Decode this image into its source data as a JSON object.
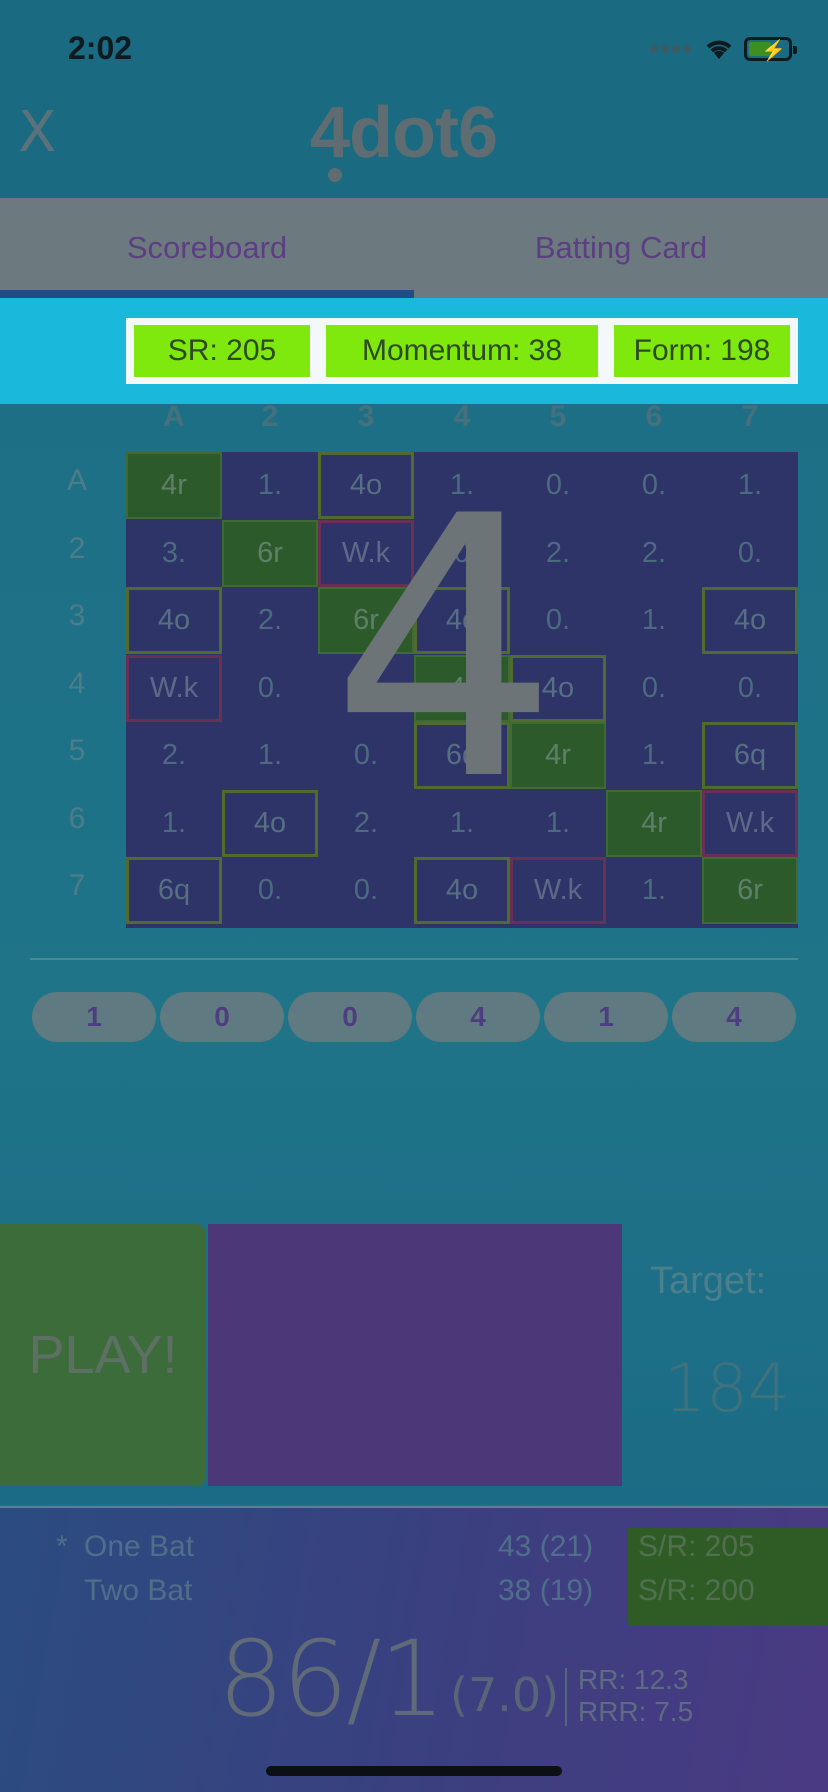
{
  "status_bar": {
    "time": "2:02"
  },
  "header": {
    "close_label": "X",
    "logo": "4dot6"
  },
  "tabs": [
    {
      "label": "Scoreboard",
      "active": true
    },
    {
      "label": "Batting Card",
      "active": false
    }
  ],
  "stats": {
    "sr": "SR: 205",
    "momentum": "Momentum: 38",
    "form": "Form: 198"
  },
  "grid": {
    "columns": [
      "A",
      "2",
      "3",
      "4",
      "5",
      "6",
      "7"
    ],
    "rows": [
      "A",
      "2",
      "3",
      "4",
      "5",
      "6",
      "7"
    ],
    "cells": [
      [
        "4r",
        "1.",
        "4o",
        "1.",
        "0.",
        "0.",
        "1."
      ],
      [
        "3.",
        "6r",
        "W.k",
        "0",
        "2.",
        "2.",
        "0."
      ],
      [
        "4o",
        "2.",
        "6r",
        "4o",
        "0.",
        "1.",
        "4o"
      ],
      [
        "W.k",
        "0.",
        "1",
        "4r",
        "4o",
        "0.",
        "0."
      ],
      [
        "2.",
        "1.",
        "0.",
        "6q",
        "4r",
        "1.",
        "6q"
      ],
      [
        "1.",
        "4o",
        "2.",
        "1.",
        "1.",
        "4r",
        "W.k"
      ],
      [
        "6q",
        "0.",
        "0.",
        "4o",
        "W.k",
        "1.",
        "6r"
      ]
    ],
    "overlay_value": "4"
  },
  "recent_balls": [
    "1",
    "0",
    "0",
    "4",
    "1",
    "4"
  ],
  "play": {
    "button_label": "PLAY!",
    "target_label": "Target:",
    "target_value": "184"
  },
  "batters": [
    {
      "marker": "*",
      "name": "One Bat",
      "score": "43 (21)",
      "strike_rate": "S/R: 205"
    },
    {
      "marker": "",
      "name": "Two Bat",
      "score": "38 (19)",
      "strike_rate": "S/R: 200"
    }
  ],
  "innings": {
    "total": "86/1",
    "overs": "(7.0)",
    "run_rate": "RR: 12.3",
    "required_rate": "RRR: 7.5"
  }
}
